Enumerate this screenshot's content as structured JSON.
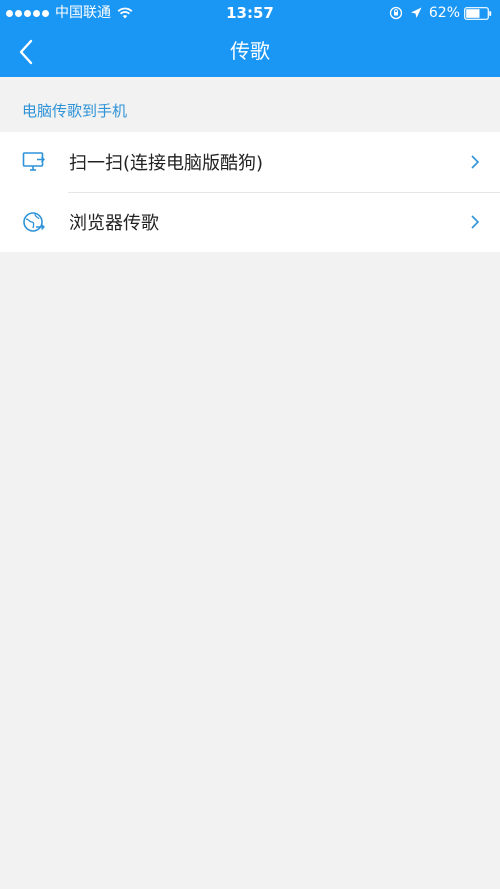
{
  "status_bar": {
    "carrier": "中国联通",
    "time": "13:57",
    "battery": "62%"
  },
  "nav": {
    "title": "传歌"
  },
  "section": {
    "label": "电脑传歌到手机"
  },
  "items": [
    {
      "label": "扫一扫(连接电脑版酷狗)",
      "icon": "computer-icon"
    },
    {
      "label": "浏览器传歌",
      "icon": "browser-globe-icon"
    }
  ],
  "colors": {
    "header_bg": "#1a96f5",
    "accent": "#2f93d8",
    "page_bg": "#f2f2f2"
  }
}
